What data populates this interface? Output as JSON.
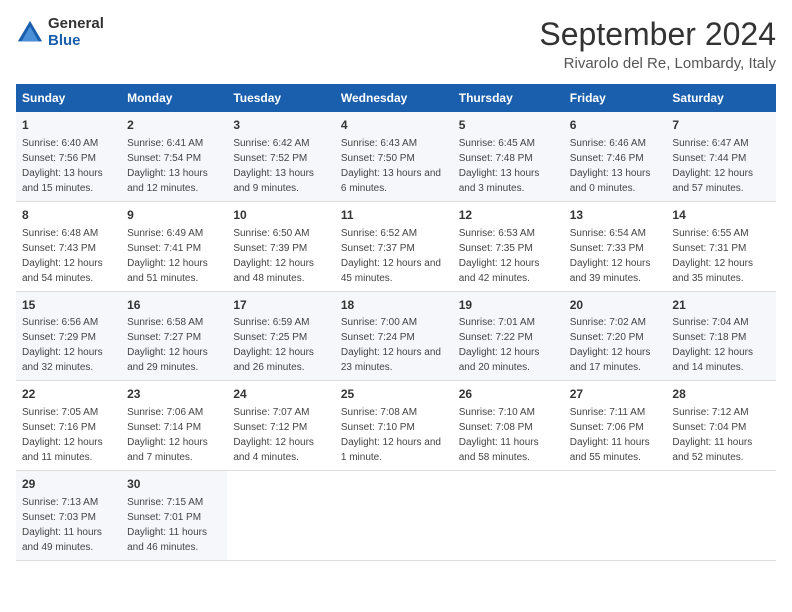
{
  "logo": {
    "general": "General",
    "blue": "Blue"
  },
  "title": "September 2024",
  "subtitle": "Rivarolo del Re, Lombardy, Italy",
  "days_of_week": [
    "Sunday",
    "Monday",
    "Tuesday",
    "Wednesday",
    "Thursday",
    "Friday",
    "Saturday"
  ],
  "weeks": [
    [
      {
        "day": "1",
        "sunrise": "Sunrise: 6:40 AM",
        "sunset": "Sunset: 7:56 PM",
        "daylight": "Daylight: 13 hours and 15 minutes."
      },
      {
        "day": "2",
        "sunrise": "Sunrise: 6:41 AM",
        "sunset": "Sunset: 7:54 PM",
        "daylight": "Daylight: 13 hours and 12 minutes."
      },
      {
        "day": "3",
        "sunrise": "Sunrise: 6:42 AM",
        "sunset": "Sunset: 7:52 PM",
        "daylight": "Daylight: 13 hours and 9 minutes."
      },
      {
        "day": "4",
        "sunrise": "Sunrise: 6:43 AM",
        "sunset": "Sunset: 7:50 PM",
        "daylight": "Daylight: 13 hours and 6 minutes."
      },
      {
        "day": "5",
        "sunrise": "Sunrise: 6:45 AM",
        "sunset": "Sunset: 7:48 PM",
        "daylight": "Daylight: 13 hours and 3 minutes."
      },
      {
        "day": "6",
        "sunrise": "Sunrise: 6:46 AM",
        "sunset": "Sunset: 7:46 PM",
        "daylight": "Daylight: 13 hours and 0 minutes."
      },
      {
        "day": "7",
        "sunrise": "Sunrise: 6:47 AM",
        "sunset": "Sunset: 7:44 PM",
        "daylight": "Daylight: 12 hours and 57 minutes."
      }
    ],
    [
      {
        "day": "8",
        "sunrise": "Sunrise: 6:48 AM",
        "sunset": "Sunset: 7:43 PM",
        "daylight": "Daylight: 12 hours and 54 minutes."
      },
      {
        "day": "9",
        "sunrise": "Sunrise: 6:49 AM",
        "sunset": "Sunset: 7:41 PM",
        "daylight": "Daylight: 12 hours and 51 minutes."
      },
      {
        "day": "10",
        "sunrise": "Sunrise: 6:50 AM",
        "sunset": "Sunset: 7:39 PM",
        "daylight": "Daylight: 12 hours and 48 minutes."
      },
      {
        "day": "11",
        "sunrise": "Sunrise: 6:52 AM",
        "sunset": "Sunset: 7:37 PM",
        "daylight": "Daylight: 12 hours and 45 minutes."
      },
      {
        "day": "12",
        "sunrise": "Sunrise: 6:53 AM",
        "sunset": "Sunset: 7:35 PM",
        "daylight": "Daylight: 12 hours and 42 minutes."
      },
      {
        "day": "13",
        "sunrise": "Sunrise: 6:54 AM",
        "sunset": "Sunset: 7:33 PM",
        "daylight": "Daylight: 12 hours and 39 minutes."
      },
      {
        "day": "14",
        "sunrise": "Sunrise: 6:55 AM",
        "sunset": "Sunset: 7:31 PM",
        "daylight": "Daylight: 12 hours and 35 minutes."
      }
    ],
    [
      {
        "day": "15",
        "sunrise": "Sunrise: 6:56 AM",
        "sunset": "Sunset: 7:29 PM",
        "daylight": "Daylight: 12 hours and 32 minutes."
      },
      {
        "day": "16",
        "sunrise": "Sunrise: 6:58 AM",
        "sunset": "Sunset: 7:27 PM",
        "daylight": "Daylight: 12 hours and 29 minutes."
      },
      {
        "day": "17",
        "sunrise": "Sunrise: 6:59 AM",
        "sunset": "Sunset: 7:25 PM",
        "daylight": "Daylight: 12 hours and 26 minutes."
      },
      {
        "day": "18",
        "sunrise": "Sunrise: 7:00 AM",
        "sunset": "Sunset: 7:24 PM",
        "daylight": "Daylight: 12 hours and 23 minutes."
      },
      {
        "day": "19",
        "sunrise": "Sunrise: 7:01 AM",
        "sunset": "Sunset: 7:22 PM",
        "daylight": "Daylight: 12 hours and 20 minutes."
      },
      {
        "day": "20",
        "sunrise": "Sunrise: 7:02 AM",
        "sunset": "Sunset: 7:20 PM",
        "daylight": "Daylight: 12 hours and 17 minutes."
      },
      {
        "day": "21",
        "sunrise": "Sunrise: 7:04 AM",
        "sunset": "Sunset: 7:18 PM",
        "daylight": "Daylight: 12 hours and 14 minutes."
      }
    ],
    [
      {
        "day": "22",
        "sunrise": "Sunrise: 7:05 AM",
        "sunset": "Sunset: 7:16 PM",
        "daylight": "Daylight: 12 hours and 11 minutes."
      },
      {
        "day": "23",
        "sunrise": "Sunrise: 7:06 AM",
        "sunset": "Sunset: 7:14 PM",
        "daylight": "Daylight: 12 hours and 7 minutes."
      },
      {
        "day": "24",
        "sunrise": "Sunrise: 7:07 AM",
        "sunset": "Sunset: 7:12 PM",
        "daylight": "Daylight: 12 hours and 4 minutes."
      },
      {
        "day": "25",
        "sunrise": "Sunrise: 7:08 AM",
        "sunset": "Sunset: 7:10 PM",
        "daylight": "Daylight: 12 hours and 1 minute."
      },
      {
        "day": "26",
        "sunrise": "Sunrise: 7:10 AM",
        "sunset": "Sunset: 7:08 PM",
        "daylight": "Daylight: 11 hours and 58 minutes."
      },
      {
        "day": "27",
        "sunrise": "Sunrise: 7:11 AM",
        "sunset": "Sunset: 7:06 PM",
        "daylight": "Daylight: 11 hours and 55 minutes."
      },
      {
        "day": "28",
        "sunrise": "Sunrise: 7:12 AM",
        "sunset": "Sunset: 7:04 PM",
        "daylight": "Daylight: 11 hours and 52 minutes."
      }
    ],
    [
      {
        "day": "29",
        "sunrise": "Sunrise: 7:13 AM",
        "sunset": "Sunset: 7:03 PM",
        "daylight": "Daylight: 11 hours and 49 minutes."
      },
      {
        "day": "30",
        "sunrise": "Sunrise: 7:15 AM",
        "sunset": "Sunset: 7:01 PM",
        "daylight": "Daylight: 11 hours and 46 minutes."
      },
      null,
      null,
      null,
      null,
      null
    ]
  ]
}
